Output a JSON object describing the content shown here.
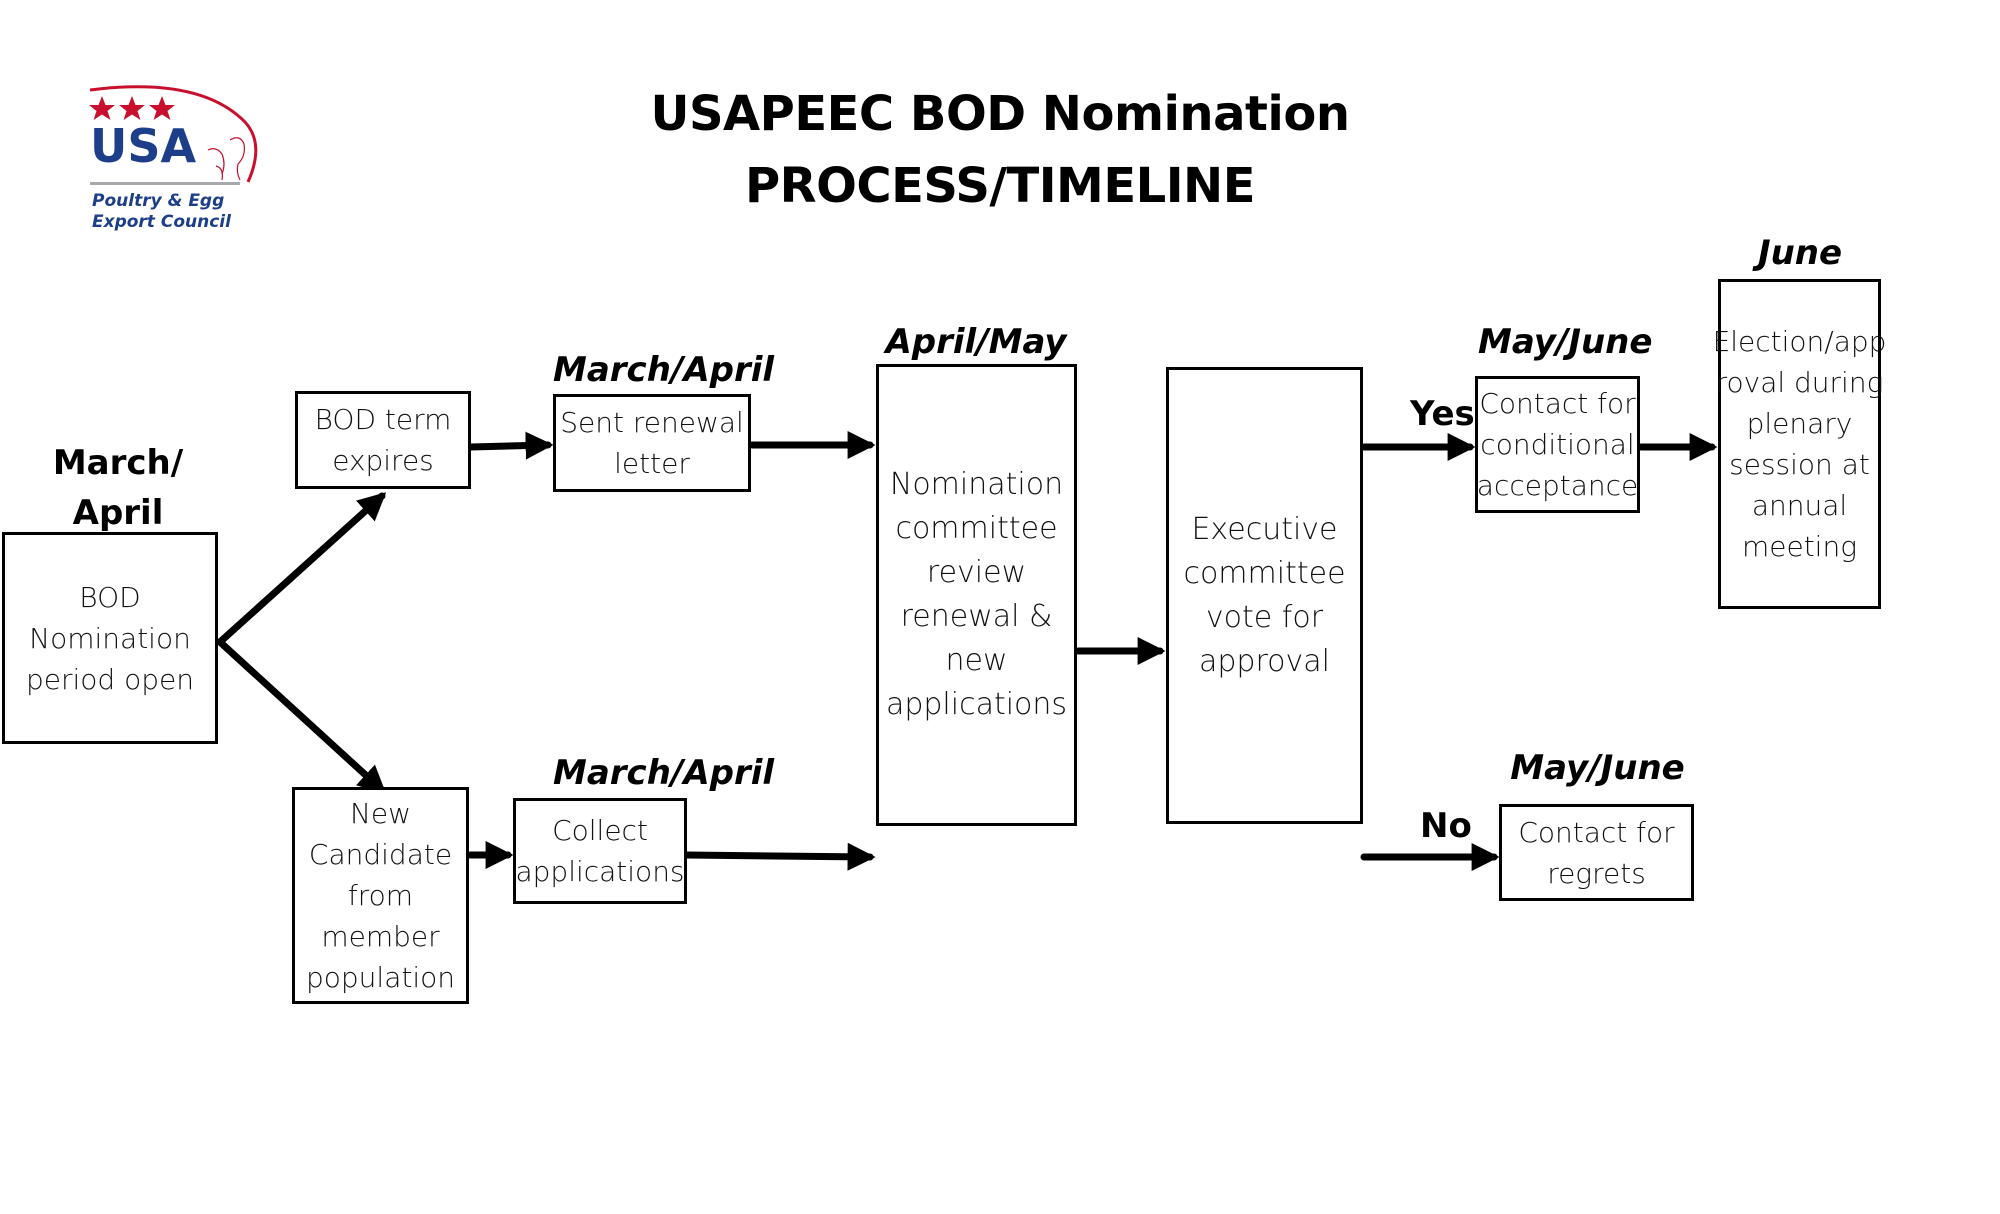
{
  "header": {
    "title_line1": "USAPEEC BOD Nomination",
    "title_line2": "PROCESS/TIMELINE"
  },
  "logo": {
    "icon": "usapeec-logo",
    "wordmark": "USA",
    "subtitle_line1": "Poultry & Egg",
    "subtitle_line2": "Export Council",
    "colors": {
      "red": "#c8102e",
      "blue": "#1d3f8a",
      "gray": "#a7a9ac"
    }
  },
  "nodes": [
    {
      "id": "bod-open",
      "date": "March/\nApril",
      "text": "BOD\nNomination\nperiod open"
    },
    {
      "id": "bod-term",
      "date": "",
      "text": "BOD term\nexpires"
    },
    {
      "id": "new-candidate",
      "date": "",
      "text": "New\nCandidate\nfrom\nmember\npopulation"
    },
    {
      "id": "sent-renewal",
      "date": "March/April",
      "text": "Sent renewal\nletter"
    },
    {
      "id": "collect",
      "date": "March/April",
      "text": "Collect\napplications"
    },
    {
      "id": "nomination-review",
      "date": "April/May",
      "text": "Nomination\ncommittee\nreview\nrenewal &\nnew\napplications"
    },
    {
      "id": "exec-vote",
      "date": "",
      "text": "Executive\ncommittee\nvote for\napproval"
    },
    {
      "id": "contact-conditional",
      "date": "May/June",
      "text": "Contact for\nconditional\nacceptance"
    },
    {
      "id": "contact-regrets",
      "date": "May/June",
      "text": "Contact for\nregrets"
    },
    {
      "id": "election",
      "date": "June",
      "text": "Election/app\nroval during\nplenary\nsession at\nannual\nmeeting"
    }
  ],
  "branches": {
    "yes": "Yes",
    "no": "No"
  },
  "edges": [
    {
      "from": "bod-open",
      "to": "bod-term"
    },
    {
      "from": "bod-open",
      "to": "new-candidate"
    },
    {
      "from": "bod-term",
      "to": "sent-renewal"
    },
    {
      "from": "new-candidate",
      "to": "collect"
    },
    {
      "from": "sent-renewal",
      "to": "nomination-review"
    },
    {
      "from": "collect",
      "to": "nomination-review"
    },
    {
      "from": "nomination-review",
      "to": "exec-vote"
    },
    {
      "from": "exec-vote",
      "to": "contact-conditional",
      "label": "Yes"
    },
    {
      "from": "exec-vote",
      "to": "contact-regrets",
      "label": "No"
    },
    {
      "from": "contact-conditional",
      "to": "election"
    }
  ]
}
